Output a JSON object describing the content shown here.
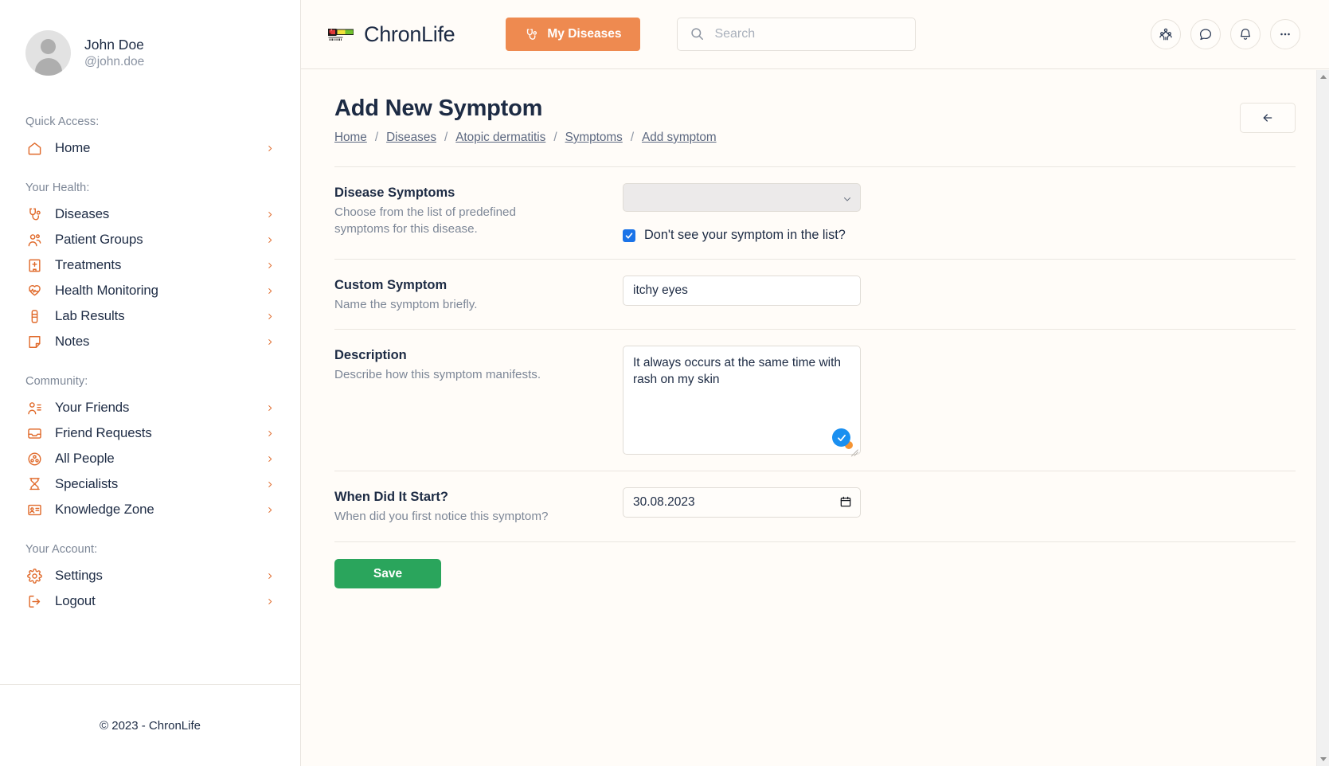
{
  "sidebar": {
    "profile": {
      "name": "John Doe",
      "handle": "@john.doe"
    },
    "groups": [
      {
        "label": "Quick Access:",
        "items": [
          {
            "label": "Home",
            "icon": "home-icon"
          }
        ]
      },
      {
        "label": "Your Health:",
        "items": [
          {
            "label": "Diseases",
            "icon": "stethoscope-icon"
          },
          {
            "label": "Patient Groups",
            "icon": "users-icon"
          },
          {
            "label": "Treatments",
            "icon": "hospital-icon"
          },
          {
            "label": "Health Monitoring",
            "icon": "heart-pulse-icon"
          },
          {
            "label": "Lab Results",
            "icon": "test-tube-icon"
          },
          {
            "label": "Notes",
            "icon": "note-icon"
          }
        ]
      },
      {
        "label": "Community:",
        "items": [
          {
            "label": "Your Friends",
            "icon": "user-list-icon"
          },
          {
            "label": "Friend Requests",
            "icon": "inbox-icon"
          },
          {
            "label": "All People",
            "icon": "globe-people-icon"
          },
          {
            "label": "Specialists",
            "icon": "doctor-icon"
          },
          {
            "label": "Knowledge Zone",
            "icon": "id-card-icon"
          }
        ]
      },
      {
        "label": "Your Account:",
        "items": [
          {
            "label": "Settings",
            "icon": "gear-icon"
          },
          {
            "label": "Logout",
            "icon": "logout-icon"
          }
        ]
      }
    ],
    "footer": "© 2023 - ChronLife"
  },
  "topbar": {
    "brand_name": "ChronLife",
    "brand_logo": "pixel-healthbar-heart-icon",
    "my_diseases_label": "My Diseases",
    "search": {
      "placeholder": "Search",
      "value": ""
    },
    "actions": [
      {
        "icon": "people-group-icon",
        "name": "people-group-button"
      },
      {
        "icon": "chat-bubble-icon",
        "name": "messages-button"
      },
      {
        "icon": "bell-icon",
        "name": "notifications-button"
      },
      {
        "icon": "ellipsis-icon",
        "name": "more-options-button"
      }
    ]
  },
  "page": {
    "title": "Add New Symptom",
    "breadcrumb": [
      "Home",
      "Diseases",
      "Atopic dermatitis",
      "Symptoms",
      "Add symptom"
    ],
    "breadcrumb_separator": "/",
    "back_icon": "arrow-left-icon"
  },
  "form": {
    "disease_symptoms": {
      "label": "Disease Symptoms",
      "help": "Choose from the list of predefined symptoms for this disease.",
      "select_value": "",
      "select_disabled": true,
      "checkbox_label": "Don't see your symptom in the list?",
      "checkbox_checked": true
    },
    "custom_symptom": {
      "label": "Custom Symptom",
      "help": "Name the symptom briefly.",
      "value": "itchy eyes",
      "placeholder": ""
    },
    "description": {
      "label": "Description",
      "help": "Describe how this symptom manifests.",
      "value": "It always occurs at the same time with rash on my skin",
      "placeholder": ""
    },
    "when_started": {
      "label": "When Did It Start?",
      "help": "When did you first notice this symptom?",
      "value": "30.08.2023",
      "icon": "calendar-icon"
    },
    "save_label": "Save"
  },
  "colors": {
    "accent_orange": "#ee8a50",
    "icon_orange": "#e06a2b",
    "save_green": "#2aa55c",
    "checkbox_blue": "#1a73e8",
    "text_dark": "#1d2b44",
    "muted": "#7d8797",
    "page_bg": "#fffcf8"
  }
}
